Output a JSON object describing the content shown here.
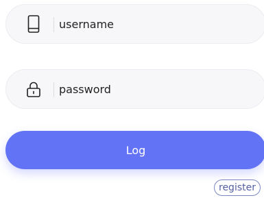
{
  "form": {
    "username": {
      "icon": "phone-icon",
      "placeholder": "username",
      "value": ""
    },
    "password": {
      "icon": "lock-icon",
      "placeholder": "password",
      "value": ""
    },
    "login_label": "Log",
    "register_label": "register"
  },
  "colors": {
    "accent": "#6373f5",
    "field_background": "#f7f7f9",
    "register_border": "#7a86bf"
  }
}
